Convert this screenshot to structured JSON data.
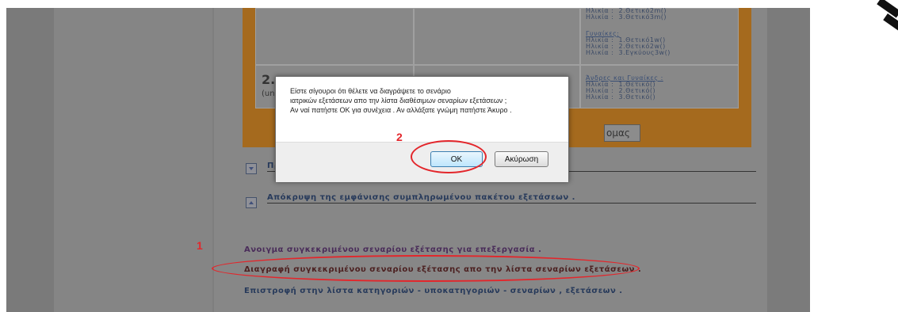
{
  "background_page": {
    "table": {
      "col3_top_lines": [
        "Ηλικία :  2.Θετικό2m()",
        "Ηλικία :  3.Θετικό3m()"
      ],
      "women_heading": "Γυναίκες:",
      "women_lines": [
        "Ηλικία :  1.Θετικό1w()",
        "Ηλικία :  2.Θετικό2w()",
        "Ηλικία :  3.Εγκύους3w()"
      ],
      "row2_number": "2.",
      "row2_sub": "(un",
      "both_heading": "Άνδρες και Γυναίκες :",
      "both_lines": [
        "Ηλικία :  1.Θετικό()",
        "Ηλικία :  2.Θετικό()",
        "Ηλικία :  3.Θετικό()"
      ],
      "hidden_button_fragment": "ομας"
    },
    "toggles": {
      "show_label_fragment": "Πρ",
      "hide_label": "Απόκρυψη της εμφάνισης συμπληρωμένου πακέτου εξετάσεων ."
    },
    "links": {
      "open": "Ανοιγμα συγκεκριμένου σεναρίου εξέτασης για επεξεργασία .",
      "delete": "Διαγραφή συγκεκριμένου σεναρίου εξέτασης απο την λίστα σεναρίων εξετάσεων .",
      "back": "Επιστροφή στην λίστα κατηγοριών - υποκατηγοριών - σεναρίων , εξετάσεων ."
    }
  },
  "dialog": {
    "message_lines": [
      "Είστε σίγουροι ότι θέλετε να διαγράψετε το σενάριο",
      " ιατρικών εξετάσεων απο την λίστα διαθέσιμων σεναρίων εξετάσεων ;",
      "Αν ναί πατήστε ΟΚ για συνέχεια . Αν αλλάξατε γνώμη πατήστε Άκυρο ."
    ],
    "ok_label": "OK",
    "cancel_label": "Ακύρωση"
  },
  "annotations": {
    "step1": "1",
    "step2": "2",
    "color": "#e3262b"
  },
  "colors": {
    "overlay_gray": "#7e7e7e",
    "orange_panel": "#a56a1e",
    "ok_button_blue": "#bee6fd"
  }
}
